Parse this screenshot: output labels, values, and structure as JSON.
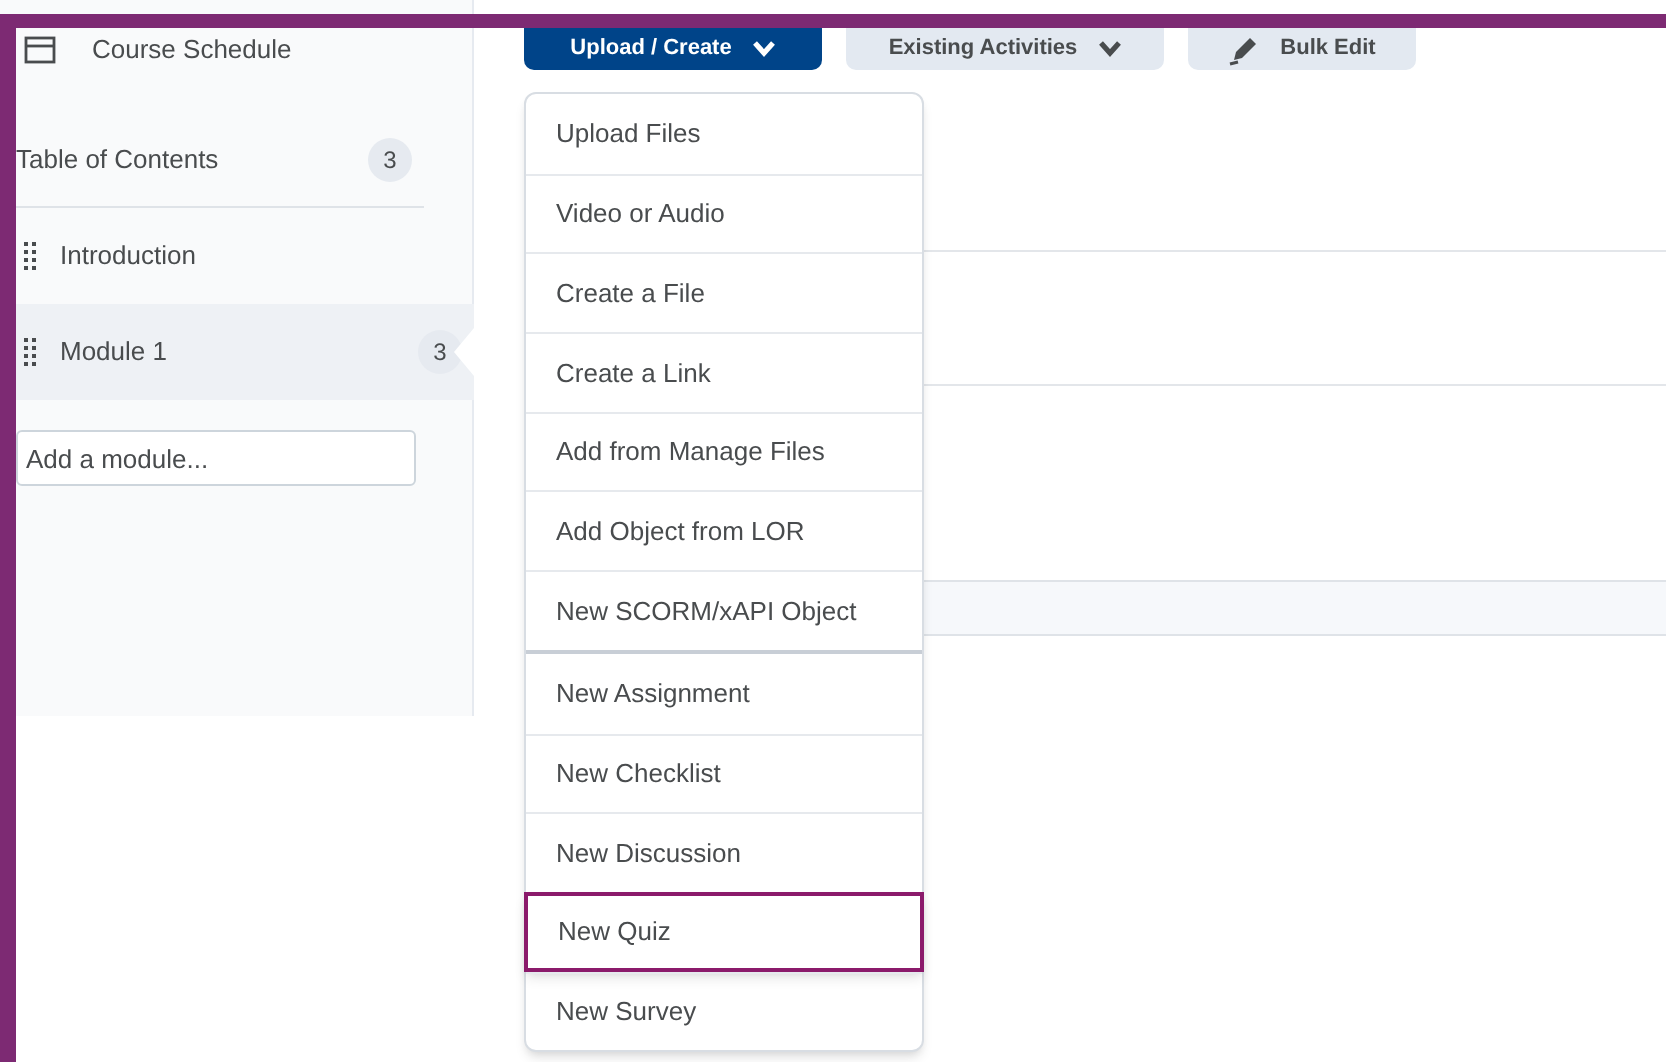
{
  "sidebar": {
    "items": [
      {
        "kind": "link",
        "label": "Course Schedule"
      },
      {
        "kind": "heading",
        "label": "Table of Contents",
        "count": "3"
      },
      {
        "kind": "module",
        "label": "Introduction",
        "selected": false
      },
      {
        "kind": "module",
        "label": "Module 1",
        "count": "3",
        "selected": true
      }
    ],
    "add_module": {
      "placeholder": "Add a module..."
    }
  },
  "toolbar": {
    "buttons": [
      {
        "kind": "primary",
        "label": "Upload / Create"
      },
      {
        "kind": "secondary",
        "label": "Existing Activities"
      },
      {
        "kind": "edit",
        "label": "Bulk Edit"
      }
    ]
  },
  "menu": {
    "groups": [
      [
        {
          "label": "Upload Files",
          "selected": false
        },
        {
          "label": "Video or Audio",
          "selected": false
        },
        {
          "label": "Create a File",
          "selected": false
        },
        {
          "label": "Create a Link",
          "selected": false
        },
        {
          "label": "Add from Manage Files",
          "selected": false
        },
        {
          "label": "Add Object from LOR",
          "selected": false
        },
        {
          "label": "New SCORM/xAPI Object",
          "selected": false
        }
      ],
      [
        {
          "label": "New Assignment",
          "selected": false
        },
        {
          "label": "New Checklist",
          "selected": false
        },
        {
          "label": "New Discussion",
          "selected": false
        },
        {
          "label": "New Quiz",
          "selected": true
        },
        {
          "label": "New Survey",
          "selected": false
        }
      ]
    ]
  }
}
